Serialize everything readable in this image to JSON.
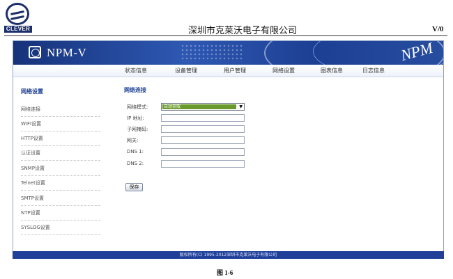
{
  "document": {
    "logo_text": "CLEVER",
    "company": "深圳市克莱沃电子有限公司",
    "version": "V/0",
    "figure_caption": "图 1-6"
  },
  "app": {
    "title": "NPM-V",
    "banner_mark": "NPM"
  },
  "topnav": [
    "状态信息",
    "设备管理",
    "用户管理",
    "网络设置",
    "图表信息",
    "日志信息"
  ],
  "sidebar": {
    "title": "网络设置",
    "items": [
      "网络连接",
      "WIFI设置",
      "HTTP设置",
      "认证设置",
      "SNMP设置",
      "Telnet设置",
      "SMTP设置",
      "NTP设置",
      "SYSLOG设置"
    ]
  },
  "content": {
    "title": "网络连接",
    "network_mode_label": "网络模式:",
    "network_mode_value": "自动获取",
    "fields": [
      {
        "label": "IP 地址:",
        "value": ""
      },
      {
        "label": "子网掩码:",
        "value": ""
      },
      {
        "label": "网关:",
        "value": ""
      },
      {
        "label": "DNS 1:",
        "value": ""
      },
      {
        "label": "DNS 2:",
        "value": ""
      }
    ],
    "save_label": "保存"
  },
  "footer": "版权所有(C) 1995-2012深圳市克莱沃电子有限公司",
  "colors": {
    "brand_blue": "#1f3f98",
    "select_highlight": "#6a9a2c"
  }
}
